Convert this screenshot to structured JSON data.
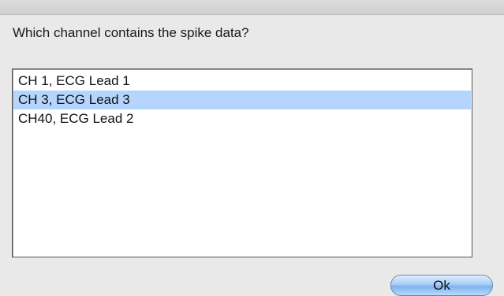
{
  "window": {
    "title": ""
  },
  "dialog": {
    "prompt": "Which channel contains the spike data?",
    "channels": [
      {
        "label": "CH 1, ECG Lead 1",
        "selected": false
      },
      {
        "label": "CH 3, ECG Lead 3",
        "selected": true
      },
      {
        "label": "CH40, ECG Lead 2",
        "selected": false
      }
    ],
    "ok_label": "Ok"
  },
  "colors": {
    "selection": "#b5d5ff",
    "button_accent": "#7eb3ee"
  }
}
